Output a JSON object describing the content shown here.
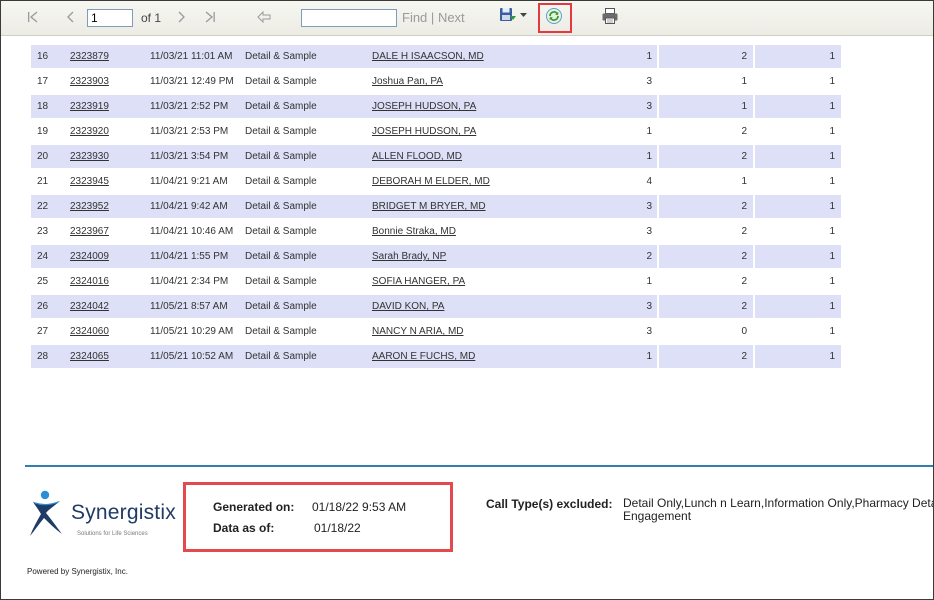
{
  "toolbar": {
    "page_input": "1",
    "page_of": "of 1",
    "find_label": "Find",
    "find_sep": "|",
    "next_label": "Next",
    "find_value": ""
  },
  "table": {
    "rows": [
      {
        "num": "16",
        "id": "2323879",
        "datetime": "11/03/21 11:01 AM",
        "type": "Detail & Sample",
        "name": "DALE H ISAACSON, MD",
        "v1": "1",
        "v2": "2",
        "v3": "1"
      },
      {
        "num": "17",
        "id": "2323903",
        "datetime": "11/03/21 12:49 PM",
        "type": "Detail & Sample",
        "name": "Joshua Pan, PA",
        "v1": "3",
        "v2": "1",
        "v3": "1"
      },
      {
        "num": "18",
        "id": "2323919",
        "datetime": "11/03/21 2:52 PM",
        "type": "Detail & Sample",
        "name": "JOSEPH HUDSON, PA",
        "v1": "3",
        "v2": "1",
        "v3": "1"
      },
      {
        "num": "19",
        "id": "2323920",
        "datetime": "11/03/21 2:53 PM",
        "type": "Detail & Sample",
        "name": "JOSEPH HUDSON, PA",
        "v1": "1",
        "v2": "2",
        "v3": "1"
      },
      {
        "num": "20",
        "id": "2323930",
        "datetime": "11/03/21 3:54 PM",
        "type": "Detail & Sample",
        "name": "ALLEN FLOOD, MD",
        "v1": "1",
        "v2": "2",
        "v3": "1"
      },
      {
        "num": "21",
        "id": "2323945",
        "datetime": "11/04/21 9:21 AM",
        "type": "Detail & Sample",
        "name": "DEBORAH M ELDER, MD",
        "v1": "4",
        "v2": "1",
        "v3": "1"
      },
      {
        "num": "22",
        "id": "2323952",
        "datetime": "11/04/21 9:42 AM",
        "type": "Detail & Sample",
        "name": "BRIDGET M BRYER, MD",
        "v1": "3",
        "v2": "2",
        "v3": "1"
      },
      {
        "num": "23",
        "id": "2323967",
        "datetime": "11/04/21 10:46 AM",
        "type": "Detail & Sample",
        "name": "Bonnie  Straka, MD",
        "v1": "3",
        "v2": "2",
        "v3": "1"
      },
      {
        "num": "24",
        "id": "2324009",
        "datetime": "11/04/21 1:55 PM",
        "type": "Detail & Sample",
        "name": "Sarah Brady, NP",
        "v1": "2",
        "v2": "2",
        "v3": "1"
      },
      {
        "num": "25",
        "id": "2324016",
        "datetime": "11/04/21 2:34 PM",
        "type": "Detail & Sample",
        "name": "SOFIA HANGER, PA",
        "v1": "1",
        "v2": "2",
        "v3": "1"
      },
      {
        "num": "26",
        "id": "2324042",
        "datetime": "11/05/21 8:57 AM",
        "type": "Detail & Sample",
        "name": "DAVID KON, PA",
        "v1": "3",
        "v2": "2",
        "v3": "1"
      },
      {
        "num": "27",
        "id": "2324060",
        "datetime": "11/05/21 10:29 AM",
        "type": "Detail & Sample",
        "name": "NANCY N ARIA, MD",
        "v1": "3",
        "v2": "0",
        "v3": "1"
      },
      {
        "num": "28",
        "id": "2324065",
        "datetime": "11/05/21 10:52 AM",
        "type": "Detail & Sample",
        "name": "AARON E FUCHS, MD",
        "v1": "1",
        "v2": "2",
        "v3": "1"
      }
    ]
  },
  "footer": {
    "logo_name": "Synergistix",
    "logo_tagline": "Solutions for Life Sciences",
    "powered_by": "Powered by Synergistix, Inc.",
    "generated_label": "Generated on:",
    "generated_value": "01/18/22 9:53 AM",
    "data_as_of_label": "Data as of:",
    "data_as_of_value": "01/18/22",
    "call_types_label": "Call Type(s) excluded:",
    "call_types_line1": "Detail Only,Lunch n Learn,Information Only,Pharmacy Detail,",
    "call_types_line2": "Engagement"
  },
  "colors": {
    "row_alt": "#dde0f7",
    "highlight": "#e5393f",
    "rule": "#2f7fb3",
    "brand": "#1f3b66",
    "brand_accent": "#2a8fd6"
  }
}
